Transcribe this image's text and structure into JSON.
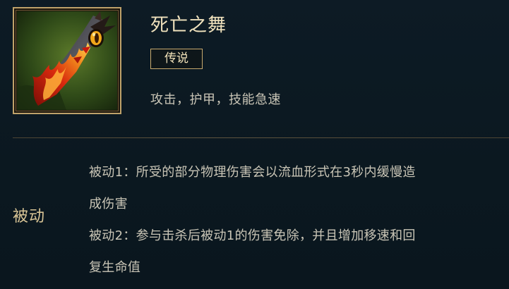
{
  "item": {
    "name": "死亡之舞",
    "rarity": "传说",
    "stats": "攻击，护甲，技能急速",
    "icon": "sword-item-icon",
    "colors": {
      "frame": "#bfa26a",
      "name": "#f0e2bd",
      "background": "#0c1a23",
      "section_label": "#d9c596",
      "body_text": "#c9c5b6"
    }
  },
  "passive": {
    "label": "被动",
    "lines": [
      [
        "被动1：所受的部分物理伤害会以流血形式在3秒内缓慢造",
        "成伤害"
      ],
      [
        "被动2：参与击杀后被动1的伤害免除，并且增加移速和回",
        "复生命值"
      ]
    ]
  }
}
